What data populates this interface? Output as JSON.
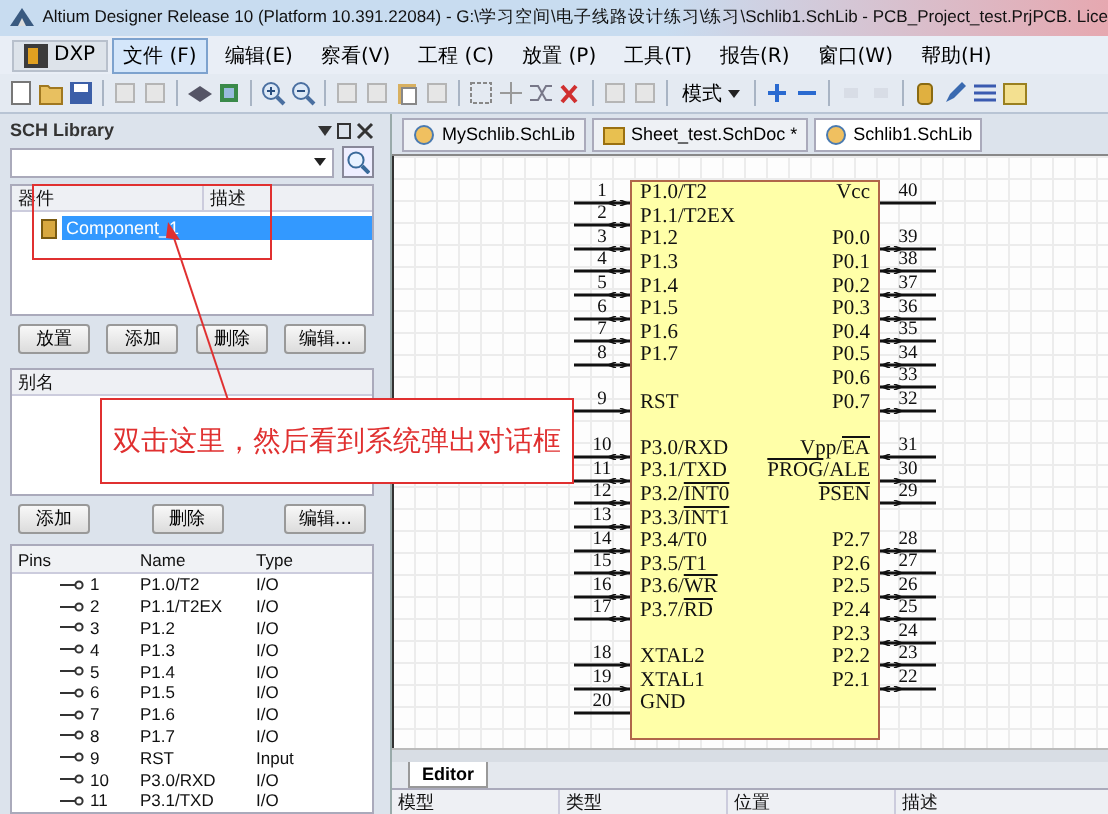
{
  "window": {
    "title": "Altium Designer Release 10 (Platform 10.391.22084) - G:\\学习空间\\电子线路设计练习\\练习\\Schlib1.SchLib - PCB_Project_test.PrjPCB. Lice"
  },
  "menu": {
    "dxp_label": "DXP",
    "items": [
      {
        "label": "文件 (F)",
        "selected": true
      },
      {
        "label": "编辑(E)",
        "selected": false
      },
      {
        "label": "察看(V)",
        "selected": false
      },
      {
        "label": "工程 (C)",
        "selected": false
      },
      {
        "label": "放置 (P)",
        "selected": false
      },
      {
        "label": "工具(T)",
        "selected": false
      },
      {
        "label": "报告(R)",
        "selected": false
      },
      {
        "label": "窗口(W)",
        "selected": false
      },
      {
        "label": "帮助(H)",
        "selected": false
      }
    ]
  },
  "toolbar": {
    "mode_label": "模式"
  },
  "panel": {
    "title": "SCH Library",
    "components": {
      "columns": [
        "器件",
        "描述"
      ],
      "rows": [
        {
          "name": "Component_1",
          "selected": true
        }
      ]
    },
    "component_buttons": [
      "放置",
      "添加",
      "删除",
      "编辑..."
    ],
    "aliases": {
      "columns": [
        "别名"
      ]
    },
    "alias_buttons": [
      "添加",
      "删除",
      "编辑..."
    ],
    "pins": {
      "columns": [
        "Pins",
        "Name",
        "Type"
      ],
      "rows": [
        {
          "pin": "1",
          "name": "P1.0/T2",
          "type": "I/O"
        },
        {
          "pin": "2",
          "name": "P1.1/T2EX",
          "type": "I/O"
        },
        {
          "pin": "3",
          "name": "P1.2",
          "type": "I/O"
        },
        {
          "pin": "4",
          "name": "P1.3",
          "type": "I/O"
        },
        {
          "pin": "5",
          "name": "P1.4",
          "type": "I/O"
        },
        {
          "pin": "6",
          "name": "P1.5",
          "type": "I/O"
        },
        {
          "pin": "7",
          "name": "P1.6",
          "type": "I/O"
        },
        {
          "pin": "8",
          "name": "P1.7",
          "type": "I/O"
        },
        {
          "pin": "9",
          "name": "RST",
          "type": "Input"
        },
        {
          "pin": "10",
          "name": "P3.0/RXD",
          "type": "I/O"
        },
        {
          "pin": "11",
          "name": "P3.1/TXD",
          "type": "I/O"
        }
      ]
    }
  },
  "doc_tabs": [
    {
      "label": "MySchlib.SchLib",
      "kind": "library",
      "selected": false
    },
    {
      "label": "Sheet_test.SchDoc *",
      "kind": "sheet",
      "selected": false
    },
    {
      "label": "Schlib1.SchLib",
      "kind": "library",
      "selected": true
    }
  ],
  "chip_rows": [
    {
      "left": {
        "number": "1",
        "name": [
          {
            "text": "P1.0/T2"
          }
        ],
        "kind": "io"
      },
      "right": {
        "number": "40",
        "name": [
          {
            "text": "Vcc"
          }
        ],
        "kind": "power"
      }
    },
    {
      "left": {
        "number": "2",
        "name": [
          {
            "text": "P1.1/T2EX"
          }
        ],
        "kind": "io"
      },
      "right": null
    },
    {
      "left": {
        "number": "3",
        "name": [
          {
            "text": "P1.2"
          }
        ],
        "kind": "io"
      },
      "right": {
        "number": "39",
        "name": [
          {
            "text": "P0.0"
          }
        ],
        "kind": "io"
      }
    },
    {
      "left": {
        "number": "4",
        "name": [
          {
            "text": "P1.3"
          }
        ],
        "kind": "io"
      },
      "right": {
        "number": "38",
        "name": [
          {
            "text": "P0.1"
          }
        ],
        "kind": "io"
      }
    },
    {
      "left": {
        "number": "5",
        "name": [
          {
            "text": "P1.4"
          }
        ],
        "kind": "io"
      },
      "right": {
        "number": "37",
        "name": [
          {
            "text": "P0.2"
          }
        ],
        "kind": "io"
      }
    },
    {
      "left": {
        "number": "6",
        "name": [
          {
            "text": "P1.5"
          }
        ],
        "kind": "io"
      },
      "right": {
        "number": "36",
        "name": [
          {
            "text": "P0.3"
          }
        ],
        "kind": "io"
      }
    },
    {
      "left": {
        "number": "7",
        "name": [
          {
            "text": "P1.6"
          }
        ],
        "kind": "io"
      },
      "right": {
        "number": "35",
        "name": [
          {
            "text": "P0.4"
          }
        ],
        "kind": "io"
      }
    },
    {
      "left": {
        "number": "8",
        "name": [
          {
            "text": "P1.7"
          }
        ],
        "kind": "io"
      },
      "right": {
        "number": "34",
        "name": [
          {
            "text": "P0.5"
          }
        ],
        "kind": "io"
      }
    },
    {
      "left": null,
      "right": {
        "number": "33",
        "name": [
          {
            "text": "P0.6"
          }
        ],
        "kind": "io"
      }
    },
    {
      "left": {
        "number": "9",
        "name": [
          {
            "text": "RST"
          }
        ],
        "kind": "input"
      },
      "right": {
        "number": "32",
        "name": [
          {
            "text": "P0.7"
          }
        ],
        "kind": "io"
      }
    },
    {
      "left": null,
      "right": null
    },
    {
      "left": {
        "number": "10",
        "name": [
          {
            "text": "P3.0/RXD"
          }
        ],
        "kind": "io"
      },
      "right": {
        "number": "31",
        "name": [
          {
            "text": "Vpp/"
          },
          {
            "text": "EA",
            "overline": true
          }
        ],
        "kind": "input"
      }
    },
    {
      "left": {
        "number": "11",
        "name": [
          {
            "text": "P3.1/TXD"
          }
        ],
        "kind": "io"
      },
      "right": {
        "number": "30",
        "name": [
          {
            "text": "PROG",
            "overline": true
          },
          {
            "text": "/ALE"
          }
        ],
        "kind": "output"
      }
    },
    {
      "left": {
        "number": "12",
        "name": [
          {
            "text": "P3.2/"
          },
          {
            "text": "INT0",
            "overline": true
          }
        ],
        "kind": "io"
      },
      "right": {
        "number": "29",
        "name": [
          {
            "text": "PSEN",
            "overline": true
          }
        ],
        "kind": "output"
      }
    },
    {
      "left": {
        "number": "13",
        "name": [
          {
            "text": "P3.3/"
          },
          {
            "text": "INT1",
            "overline": true
          }
        ],
        "kind": "io"
      },
      "right": null
    },
    {
      "left": {
        "number": "14",
        "name": [
          {
            "text": "P3.4/T0"
          }
        ],
        "kind": "io"
      },
      "right": {
        "number": "28",
        "name": [
          {
            "text": "P2.7"
          }
        ],
        "kind": "io"
      }
    },
    {
      "left": {
        "number": "15",
        "name": [
          {
            "text": "P3.5/T1"
          }
        ],
        "kind": "io"
      },
      "right": {
        "number": "27",
        "name": [
          {
            "text": "P2.6"
          }
        ],
        "kind": "io"
      }
    },
    {
      "left": {
        "number": "16",
        "name": [
          {
            "text": "P3.6/"
          },
          {
            "text": "WR",
            "overline": true
          }
        ],
        "kind": "io"
      },
      "right": {
        "number": "26",
        "name": [
          {
            "text": "P2.5"
          }
        ],
        "kind": "io"
      }
    },
    {
      "left": {
        "number": "17",
        "name": [
          {
            "text": "P3.7/"
          },
          {
            "text": "RD",
            "overline": true
          }
        ],
        "kind": "io"
      },
      "right": {
        "number": "25",
        "name": [
          {
            "text": "P2.4"
          }
        ],
        "kind": "io"
      }
    },
    {
      "left": null,
      "right": {
        "number": "24",
        "name": [
          {
            "text": "P2.3"
          }
        ],
        "kind": "io"
      }
    },
    {
      "left": {
        "number": "18",
        "name": [
          {
            "text": "XTAL2"
          }
        ],
        "kind": "input"
      },
      "right": {
        "number": "23",
        "name": [
          {
            "text": "P2.2"
          }
        ],
        "kind": "io"
      }
    },
    {
      "left": {
        "number": "19",
        "name": [
          {
            "text": "XTAL1"
          }
        ],
        "kind": "input"
      },
      "right": {
        "number": "22",
        "name": [
          {
            "text": "P2.1"
          }
        ],
        "kind": "io"
      }
    },
    {
      "left": {
        "number": "20",
        "name": [
          {
            "text": "GND"
          }
        ],
        "kind": "power"
      },
      "right": null
    }
  ],
  "editor_tab": {
    "label": "Editor",
    "selected": true
  },
  "models": {
    "columns": [
      "模型",
      "类型",
      "位置",
      "描述"
    ]
  },
  "callout": {
    "text": "双击这里，然后看到系统弹出对话框"
  }
}
